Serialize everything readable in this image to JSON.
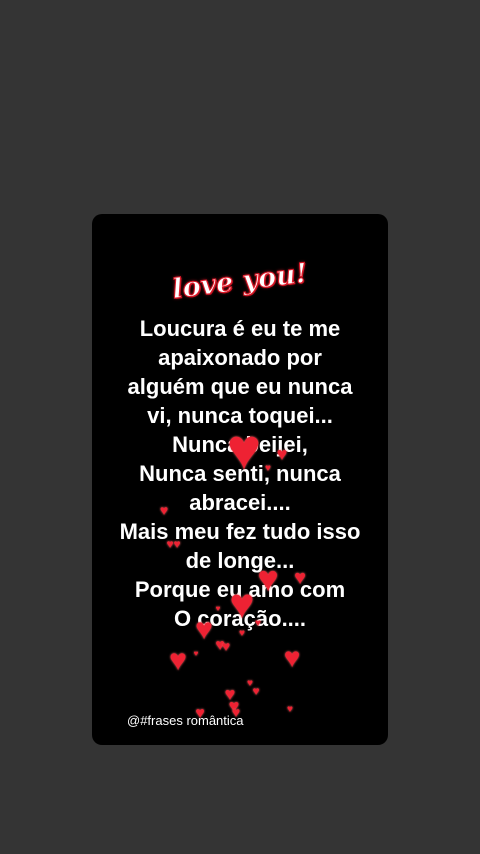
{
  "card": {
    "logo_text": "love you!",
    "quote_lines": [
      "Loucura é eu te me",
      "apaixonado por",
      "alguém que eu nunca",
      "vi, nunca toquei...",
      "Nunca beijei,",
      "Nunca senti, nunca",
      "abracei....",
      "Mais meu fez tudo isso",
      "de longe...",
      "Porque eu amo com",
      "O coração...."
    ],
    "footer_text": "@#frases romântica",
    "heart_icon": "heart-icon"
  },
  "colors": {
    "page_background": "#343434",
    "card_background": "#000000",
    "heart": "#ee2233",
    "text": "#ffffff"
  }
}
